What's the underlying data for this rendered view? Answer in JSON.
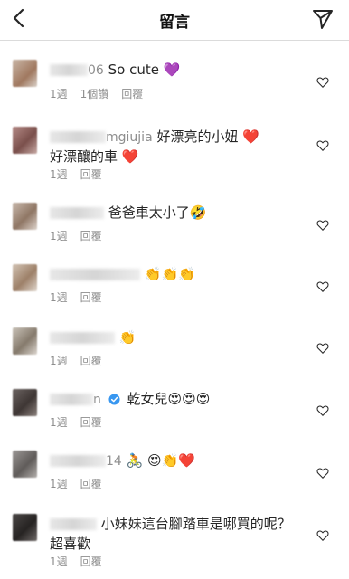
{
  "header": {
    "title": "留言"
  },
  "comments": [
    {
      "username_tail": "06",
      "text": "So cute 💜",
      "line2": "",
      "time": "1週",
      "likes": "1個讚",
      "reply": "回覆"
    },
    {
      "username_tail": "mgiujia",
      "text": "好漂亮的小妞 ❤️",
      "line2": "好漂釀的車 ❤️",
      "time": "1週",
      "likes": "",
      "reply": "回覆"
    },
    {
      "username_tail": "",
      "text": "爸爸車太小了🤣",
      "line2": "",
      "time": "1週",
      "likes": "",
      "reply": "回覆"
    },
    {
      "username_tail": "",
      "text": "👏👏👏",
      "line2": "",
      "time": "1週",
      "likes": "",
      "reply": "回覆"
    },
    {
      "username_tail": "",
      "text": "👏",
      "line2": "",
      "time": "1週",
      "likes": "",
      "reply": "回覆"
    },
    {
      "username_tail": "n",
      "text": "乾女兒😍😍😍",
      "line2": "",
      "time": "1週",
      "likes": "",
      "reply": "回覆"
    },
    {
      "username_tail": "14",
      "text": "🚴 😍👏❤️",
      "line2": "",
      "time": "1週",
      "likes": "",
      "reply": "回覆"
    },
    {
      "username_tail": "",
      "text": "小妹妹這台腳踏車是哪買的呢？",
      "line2": "超喜歡",
      "time": "1週",
      "likes": "",
      "reply": "回覆"
    }
  ]
}
